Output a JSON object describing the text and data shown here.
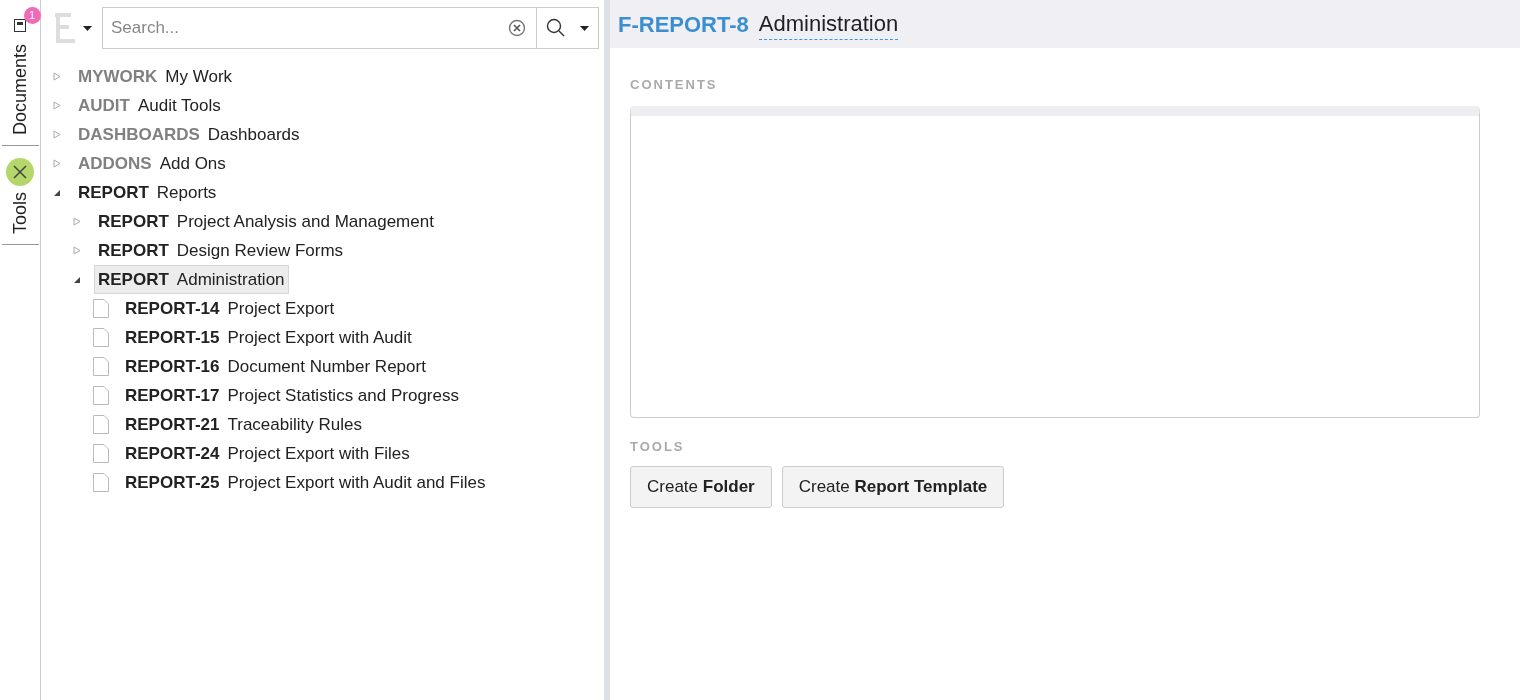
{
  "rail": {
    "tabs": [
      {
        "label": "Documents",
        "badge": "1"
      },
      {
        "label": "Tools"
      }
    ]
  },
  "search": {
    "placeholder": "Search..."
  },
  "tree": [
    {
      "key": "MYWORK",
      "label": "My Work",
      "kind": "folder",
      "muted": true,
      "expanded": false,
      "selected": false
    },
    {
      "key": "AUDIT",
      "label": "Audit Tools",
      "kind": "folder",
      "muted": true,
      "expanded": false,
      "selected": false
    },
    {
      "key": "DASHBOARDS",
      "label": "Dashboards",
      "kind": "folder",
      "muted": true,
      "expanded": false,
      "selected": false
    },
    {
      "key": "ADDONS",
      "label": "Add Ons",
      "kind": "folder",
      "muted": true,
      "expanded": false,
      "selected": false
    },
    {
      "key": "REPORT",
      "label": "Reports",
      "kind": "folder",
      "muted": false,
      "expanded": true,
      "selected": false,
      "children": [
        {
          "key": "REPORT",
          "label": "Project Analysis and Management",
          "kind": "folder",
          "muted": false,
          "expanded": false,
          "selected": false
        },
        {
          "key": "REPORT",
          "label": "Design Review Forms",
          "kind": "folder",
          "muted": false,
          "expanded": false,
          "selected": false
        },
        {
          "key": "REPORT",
          "label": "Administration",
          "kind": "folder",
          "muted": false,
          "expanded": true,
          "selected": true,
          "children": [
            {
              "key": "REPORT-14",
              "label": "Project Export",
              "kind": "document",
              "muted": false,
              "selected": false
            },
            {
              "key": "REPORT-15",
              "label": "Project Export with Audit",
              "kind": "document",
              "muted": false,
              "selected": false
            },
            {
              "key": "REPORT-16",
              "label": "Document Number Report",
              "kind": "document",
              "muted": false,
              "selected": false
            },
            {
              "key": "REPORT-17",
              "label": "Project Statistics and Progress",
              "kind": "document",
              "muted": false,
              "selected": false
            },
            {
              "key": "REPORT-21",
              "label": "Traceability Rules",
              "kind": "document",
              "muted": false,
              "selected": false
            },
            {
              "key": "REPORT-24",
              "label": "Project Export with Files",
              "kind": "document",
              "muted": false,
              "selected": false
            },
            {
              "key": "REPORT-25",
              "label": "Project Export with Audit and Files",
              "kind": "document",
              "muted": false,
              "selected": false
            }
          ]
        }
      ]
    }
  ],
  "header": {
    "id": "F-REPORT-8",
    "title": "Administration"
  },
  "contents": {
    "heading": "CONTENTS"
  },
  "tools": {
    "heading": "TOOLS",
    "buttons": [
      "Create **Folder**",
      "Create **Report Template**"
    ]
  }
}
